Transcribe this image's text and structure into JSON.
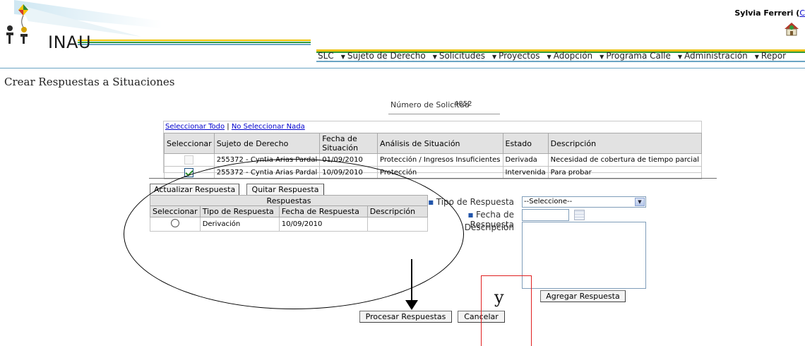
{
  "header": {
    "logo_text": "INAU",
    "user_name": "Sylvia Ferreri",
    "user_link_prefix": " (",
    "user_link": "C"
  },
  "nav": [
    {
      "label": "SLC",
      "dropdown": false
    },
    {
      "label": "Sujeto de Derecho",
      "dropdown": true
    },
    {
      "label": "Solicitudes",
      "dropdown": true
    },
    {
      "label": "Proyectos",
      "dropdown": true
    },
    {
      "label": "Adopción",
      "dropdown": true
    },
    {
      "label": "Programa Calle",
      "dropdown": true
    },
    {
      "label": "Administración",
      "dropdown": true
    },
    {
      "label": "Repor",
      "dropdown": true
    }
  ],
  "page": {
    "title": "Crear Respuestas a Situaciones",
    "solicitud_label": "Número de Solicitud",
    "solicitud_number": "4852"
  },
  "situaciones": {
    "select_all": "Seleccionar Todo",
    "separator": "|",
    "select_none": "No Seleccionar Nada",
    "headers": [
      "Seleccionar",
      "Sujeto de Derecho",
      "Fecha de Situación",
      "Análisis de Situación",
      "Estado",
      "Descripción"
    ],
    "rows": [
      {
        "checked": false,
        "sujeto": "255372 - Cyntia Arias Pardal",
        "fecha": "01/09/2010",
        "analisis": "Protección / Ingresos Insuficientes",
        "estado": "Derivada",
        "descripcion": "Necesidad de cobertura de tiempo parcial"
      },
      {
        "checked": true,
        "sujeto": "255372 - Cyntia Arias Pardal",
        "fecha": "10/09/2010",
        "analisis": "Protección",
        "estado": "Intervenida",
        "descripcion": "Para probar"
      }
    ]
  },
  "respuestas": {
    "actualizar_label": "Actualizar Respuesta",
    "quitar_label": "Quitar Respuesta",
    "caption": "Respuestas",
    "headers": [
      "Seleccionar",
      "Tipo de Respuesta",
      "Fecha de Respuesta",
      "Descripción"
    ],
    "rows": [
      {
        "selected": false,
        "tipo": "Derivación",
        "fecha": "10/09/2010",
        "descripcion": ""
      }
    ]
  },
  "form": {
    "tipo_label": "Tipo de Respuesta",
    "tipo_value": "--Seleccione--",
    "fecha_label": "Fecha de Respuesta",
    "fecha_value": "",
    "descripcion_label": "Descripción",
    "descripcion_value": "",
    "agregar_label": "Agregar Respuesta"
  },
  "actions": {
    "procesar_label": "Procesar Respuestas",
    "cancelar_label": "Cancelar"
  },
  "annotation": {
    "mark": "y"
  },
  "colors": {
    "accent_line": "#6aa5c4",
    "header_bg": "#e2e2e2",
    "link": "#0000cc",
    "annotation_red": "#e02020"
  }
}
